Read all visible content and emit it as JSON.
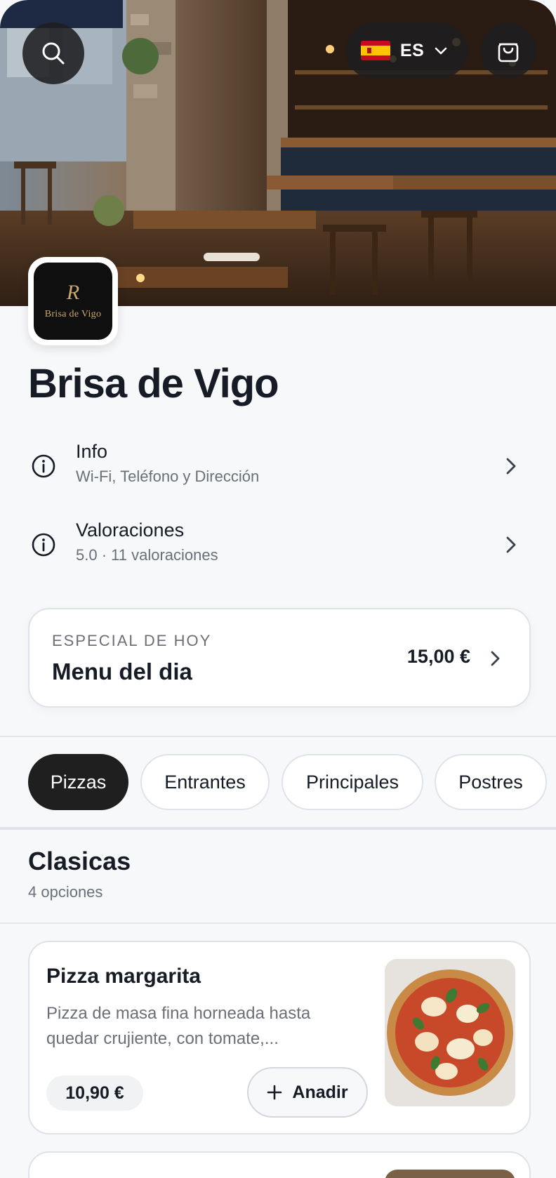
{
  "header": {
    "language_code": "ES",
    "language_flag": "spain-flag-icon"
  },
  "restaurant": {
    "name": "Brisa de Vigo",
    "logo_monogram": "R",
    "logo_text": "Brisa de Vigo"
  },
  "info_rows": [
    {
      "title": "Info",
      "subtitle": "Wi-Fi, Teléfono y Dirección",
      "icon": "info-icon"
    },
    {
      "title": "Valoraciones",
      "subtitle": "5.0 · 11 valoraciones",
      "icon": "info-icon"
    }
  ],
  "special": {
    "kicker": "ESPECIAL DE HOY",
    "name": "Menu del dia",
    "price": "15,00 €"
  },
  "tabs": [
    {
      "label": "Pizzas",
      "active": true
    },
    {
      "label": "Entrantes",
      "active": false
    },
    {
      "label": "Principales",
      "active": false
    },
    {
      "label": "Postres",
      "active": false
    }
  ],
  "section": {
    "title": "Clasicas",
    "count": "4 opciones"
  },
  "products": [
    {
      "name": "Pizza margarita",
      "description": "Pizza de masa fina horneada hasta quedar crujiente, con tomate,...",
      "price": "10,90 €",
      "add_label": "Anadir"
    }
  ],
  "colors": {
    "text": "#161b26",
    "muted": "#6b6f78",
    "active_tab": "#1f1f1f",
    "background": "#f7f8fa",
    "border": "#dfe2e8"
  }
}
